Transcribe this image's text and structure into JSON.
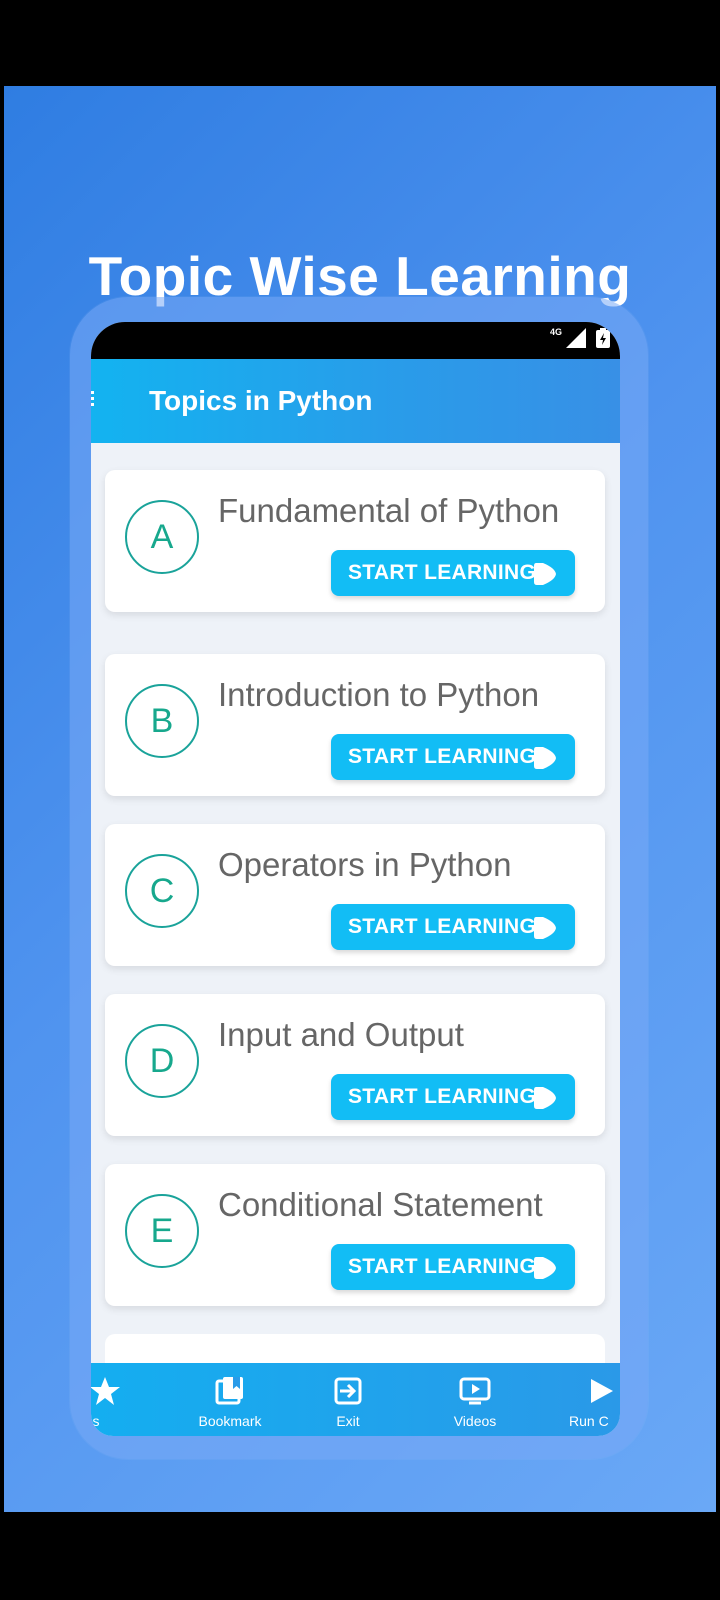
{
  "promo": {
    "headline": "Topic Wise Learning"
  },
  "status": {
    "network": "4G"
  },
  "appbar": {
    "title": "Topics in Python"
  },
  "topics": [
    {
      "letter": "A",
      "title": "Fundamental of Python",
      "button": "START LEARNING"
    },
    {
      "letter": "B",
      "title": "Introduction to Python",
      "button": "START LEARNING"
    },
    {
      "letter": "C",
      "title": "Operators in Python",
      "button": "START LEARNING"
    },
    {
      "letter": "D",
      "title": "Input and Output",
      "button": "START LEARNING"
    },
    {
      "letter": "E",
      "title": "Conditional Statement",
      "button": "START LEARNING"
    }
  ],
  "bottom_nav": [
    {
      "label": "e us",
      "icon": "star-icon"
    },
    {
      "label": "Bookmark",
      "icon": "bookmark-icon"
    },
    {
      "label": "Exit",
      "icon": "exit-icon"
    },
    {
      "label": "Videos",
      "icon": "video-icon"
    },
    {
      "label": "Run C",
      "icon": "play-icon"
    }
  ],
  "colors": {
    "accent": "#12bdf5",
    "circle": "#1aa39a",
    "background_gradient_start": "#2f7de2",
    "background_gradient_end": "#6aa8f6"
  }
}
